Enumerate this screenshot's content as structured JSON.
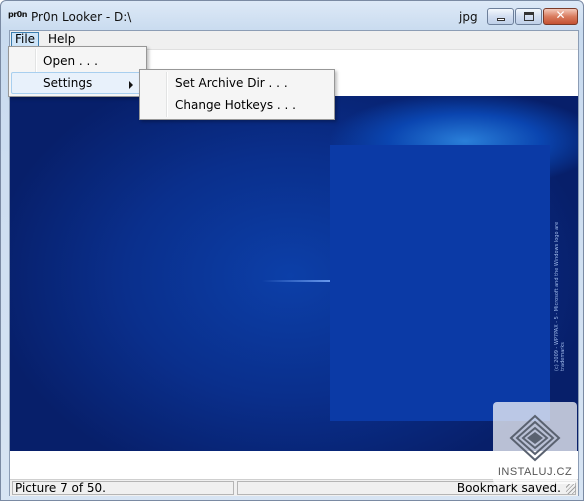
{
  "window": {
    "app_icon_label": "pr0n",
    "title": "Pr0n Looker - D:\\",
    "file_extension": "jpg"
  },
  "menubar": {
    "file_label": "File",
    "help_label": "Help"
  },
  "file_menu": {
    "items": [
      {
        "label": "Open . . ."
      },
      {
        "label": "Settings"
      }
    ]
  },
  "settings_menu": {
    "items": [
      {
        "label": "Set Archive Dir . . ."
      },
      {
        "label": "Change Hotkeys . . ."
      }
    ]
  },
  "image": {
    "side_caption": "(c) 2009 - WP7PAX - 5 - Microsoft and the Windows logo are trademarks"
  },
  "statusbar": {
    "left": "Picture 7 of 50.",
    "right": "Bookmark saved."
  },
  "watermark": {
    "text": "INSTALUJ.CZ"
  },
  "colors": {
    "accent": "#3c7fb1",
    "image_blue": "#0b3aa6"
  }
}
